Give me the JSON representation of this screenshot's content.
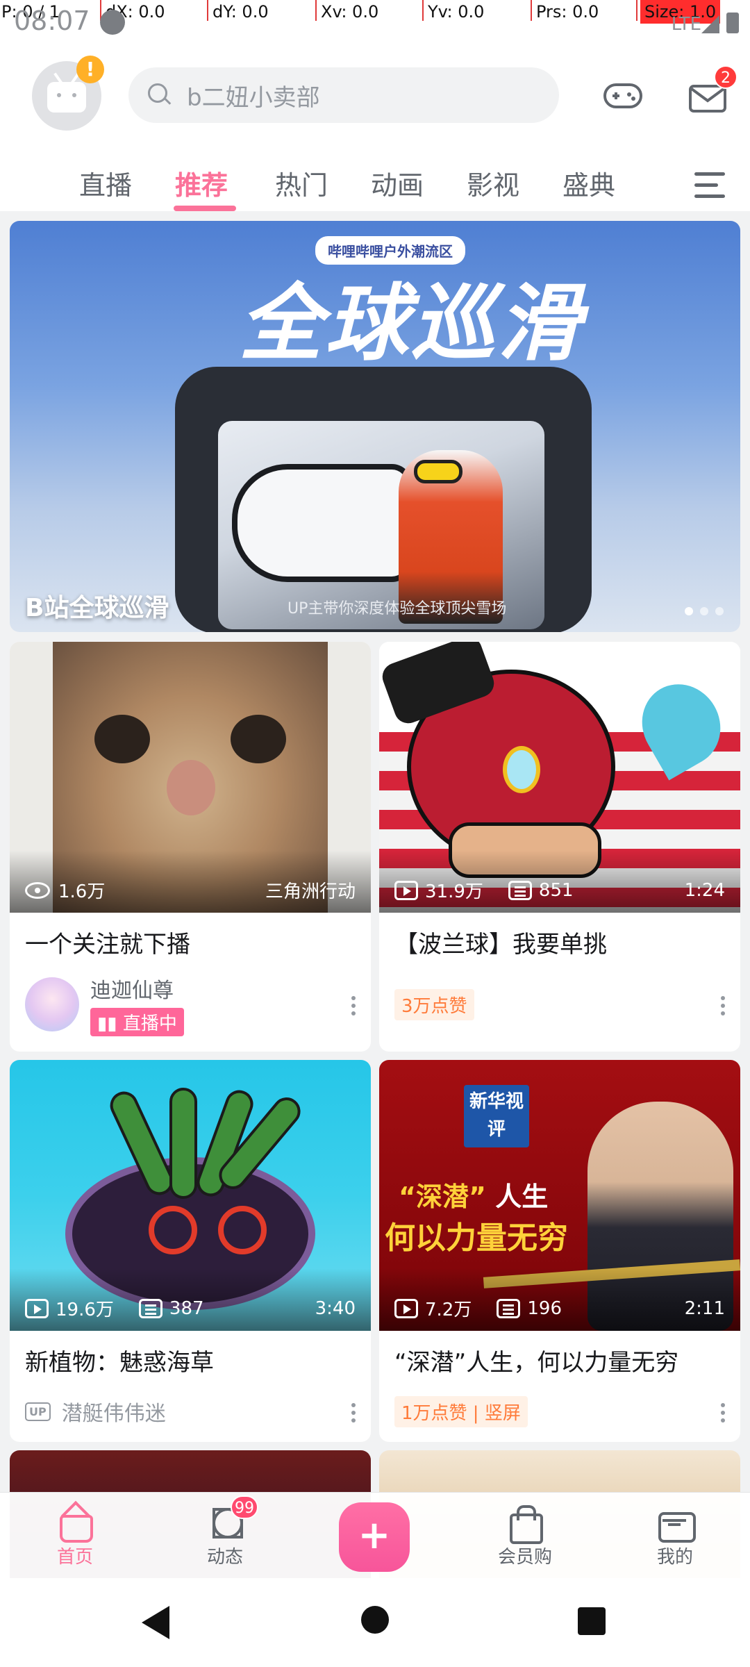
{
  "debug": {
    "pointer": "P: 0 / 1",
    "dx": "dX: 0.0",
    "dy": "dY: 0.0",
    "xv": "Xv: 0.0",
    "yv": "Yv: 0.0",
    "prs": "Prs: 0.0",
    "size": "Size: 1.0"
  },
  "status_bar": {
    "time": "08:07",
    "network": "LTE"
  },
  "header": {
    "warning_glyph": "!",
    "search_placeholder": "b二妞小卖部",
    "mail_badge": "2"
  },
  "tabs": [
    {
      "label": "直播"
    },
    {
      "label": "推荐",
      "active": true
    },
    {
      "label": "热门"
    },
    {
      "label": "动画"
    },
    {
      "label": "影视"
    },
    {
      "label": "盛典"
    }
  ],
  "banner": {
    "tag": "哔哩哔哩户外潮流区",
    "headline": "全球巡滑",
    "subtitle": "UP主带你深度体验全球顶尖雪场",
    "title": "B站全球巡滑"
  },
  "cards": [
    {
      "views": "1.6万",
      "right_text": "三角洲行动",
      "title": "一个关注就下播",
      "uploader": "迪迦仙尊",
      "live_label": "直播中"
    },
    {
      "views": "31.9万",
      "danmaku": "851",
      "duration": "1:24",
      "title": "【波兰球】我要单挑",
      "chip": "3万点赞"
    },
    {
      "views": "19.6万",
      "danmaku": "387",
      "duration": "3:40",
      "title": "新植物：魅惑海草",
      "up_badge": "UP",
      "uploader": "潜艇伟伟迷"
    },
    {
      "views": "7.2万",
      "danmaku": "196",
      "duration": "2:11",
      "title": "“深潜”人生，何以力量无穷",
      "chip": "1万点赞 | 竖屏",
      "cover_logo": "新华视评",
      "cover_line1_a": "“深潜”",
      "cover_line1_b": "人生",
      "cover_line2": "何以力量无穷"
    }
  ],
  "bottom_nav": {
    "home": "首页",
    "dynamic": "动态",
    "dynamic_badge": "99",
    "publish": "+",
    "shop": "会员购",
    "mine": "我的"
  },
  "colors": {
    "accent": "#fb7299",
    "badge_red": "#ff3b3b",
    "chip_orange": "#ff7b3a"
  }
}
